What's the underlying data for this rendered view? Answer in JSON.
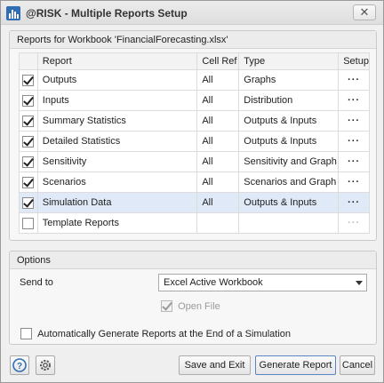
{
  "window": {
    "title": "@RISK - Multiple Reports Setup",
    "close_glyph": "✕"
  },
  "reports_group": {
    "header": "Reports for Workbook 'FinancialForecasting.xlsx'",
    "columns": [
      "Report",
      "Cell Ref",
      "Type",
      "Setup"
    ],
    "rows": [
      {
        "checked": true,
        "report": "Outputs",
        "cellref": "All",
        "type": "Graphs",
        "setup": "···"
      },
      {
        "checked": true,
        "report": "Inputs",
        "cellref": "All",
        "type": "Distribution",
        "setup": "···"
      },
      {
        "checked": true,
        "report": "Summary Statistics",
        "cellref": "All",
        "type": "Outputs & Inputs",
        "setup": "···"
      },
      {
        "checked": true,
        "report": "Detailed Statistics",
        "cellref": "All",
        "type": "Outputs & Inputs",
        "setup": "···"
      },
      {
        "checked": true,
        "report": "Sensitivity",
        "cellref": "All",
        "type": "Sensitivity and Graph",
        "setup": "···"
      },
      {
        "checked": true,
        "report": "Scenarios",
        "cellref": "All",
        "type": "Scenarios and Graph",
        "setup": "···"
      },
      {
        "checked": true,
        "report": "Simulation Data",
        "cellref": "All",
        "type": "Outputs & Inputs",
        "setup": "···",
        "selected": true
      },
      {
        "checked": false,
        "report": "Template Reports",
        "cellref": "",
        "type": "",
        "setup": "···",
        "template": true
      }
    ]
  },
  "options_group": {
    "header": "Options",
    "send_to_label": "Send to",
    "send_to_value": "Excel Active Workbook",
    "open_file_label": "Open File",
    "auto_generate_label": "Automatically Generate Reports at the End of a Simulation"
  },
  "footer": {
    "save_exit_label": "Save and Exit",
    "generate_label": "Generate Report",
    "cancel_label": "Cancel"
  },
  "icons": [
    "risk-app-icon",
    "help-icon",
    "settings-icon",
    "close-icon",
    "chevron-down-icon"
  ]
}
